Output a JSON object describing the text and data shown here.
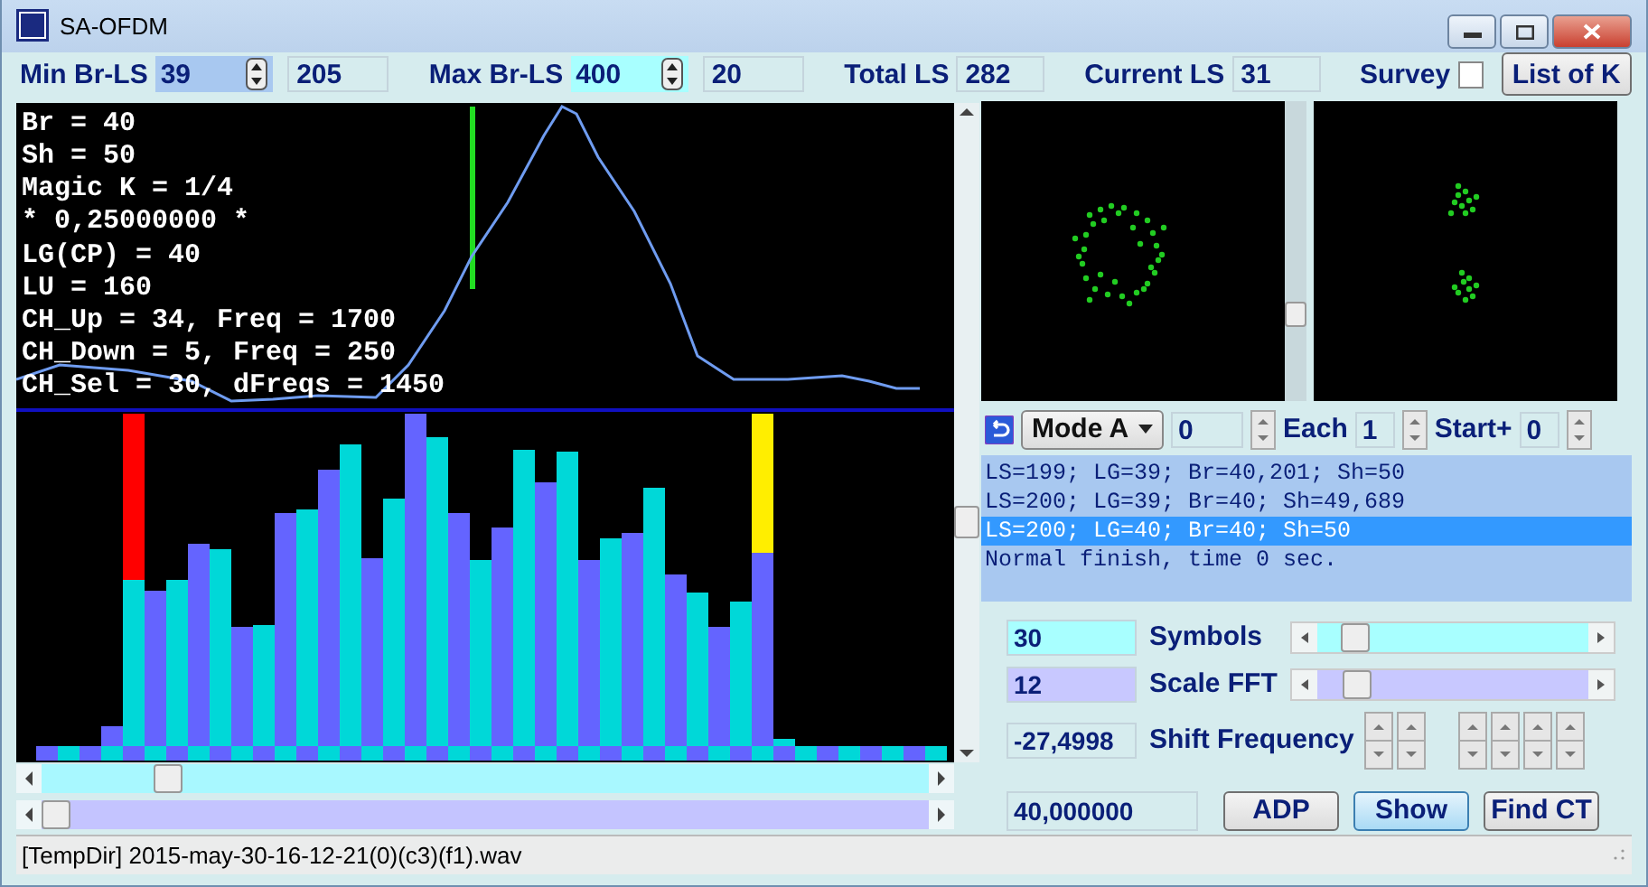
{
  "window": {
    "title": "SA-OFDM"
  },
  "toolbar": [
    {
      "kind": "spin",
      "label": "Min Br-LS",
      "value": "39",
      "color": "#a8c8f0"
    },
    {
      "kind": "readout",
      "value": "205"
    },
    {
      "kind": "spin",
      "label": "Max Br-LS",
      "value": "400",
      "color": "#a8ffff"
    },
    {
      "kind": "readout",
      "value": "20"
    },
    {
      "kind": "readout",
      "label": "Total LS",
      "value": "282"
    },
    {
      "kind": "readout",
      "label": "Current LS",
      "value": "31"
    },
    {
      "kind": "checkbox",
      "label": "Survey",
      "checked": false
    },
    {
      "kind": "button",
      "label": "List of K"
    }
  ],
  "graph": {
    "readout_lines": [
      "Br = 40",
      "Sh = 50",
      "Magic K = 1/4",
      "* 0,25000000 *",
      "LG(CP) = 40",
      "LU = 160",
      "CH_Up = 34, Freq = 1700",
      "CH_Down = 5, Freq = 250",
      "CH_Sel = 30, dFreqs = 1450"
    ]
  },
  "mode_bar": {
    "mode": "Mode A",
    "value": "0",
    "each_label": "Each",
    "each_value": "1",
    "start_label": "Start+",
    "start_value": "0"
  },
  "log": [
    {
      "text": "LS=199; LG=39; Br=40,201; Sh=50",
      "selected": false
    },
    {
      "text": "LS=200; LG=39; Br=40; Sh=49,689",
      "selected": false
    },
    {
      "text": "LS=200; LG=40; Br=40; Sh=50",
      "selected": true
    },
    {
      "text": "Normal finish, time 0 sec.",
      "selected": false
    }
  ],
  "settings": [
    {
      "kind": "slider",
      "value": "30",
      "label": "Symbols",
      "level": 0.1,
      "color": "#a8ffff"
    },
    {
      "kind": "slider",
      "value": "12",
      "label": "Scale FFT",
      "level": 0.11,
      "color": "#c8c8ff"
    },
    {
      "kind": "spinners",
      "value": "-27,4998",
      "label": "Shift Frequency"
    }
  ],
  "footer": {
    "value": "40,000000",
    "buttons": [
      {
        "label": "ADP",
        "focused": false
      },
      {
        "label": "Show",
        "focused": true
      },
      {
        "label": "Find CT",
        "focused": false
      }
    ]
  },
  "status_bar": {
    "text": "[TempDir] 2015-may-30-16-12-21(0)(c3)(f1).wav"
  }
}
